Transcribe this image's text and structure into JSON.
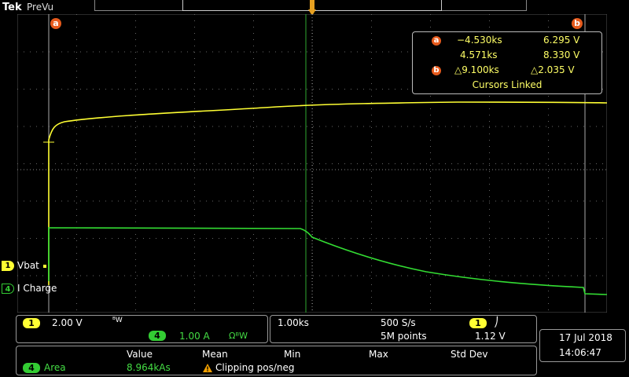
{
  "header": {
    "brand": "Tek",
    "mode": "PreVu"
  },
  "cursors": {
    "a_label": "a",
    "b_label": "b",
    "readout": {
      "a_time": "−4.530ks",
      "a_value": "6.295 V",
      "b_time": "4.571ks",
      "b_value": "8.330 V",
      "delta_time": "△9.100ks",
      "delta_value": "△2.035 V",
      "linked": "Cursors Linked"
    }
  },
  "channels": {
    "ch1": {
      "number": "1",
      "name": "Vbat",
      "scale": "2.00 V",
      "bw": "ᴮW",
      "color": "#ffff33"
    },
    "ch4": {
      "number": "4",
      "name": "I Charge",
      "scale": "1.00 A",
      "bw": "ΩᴮW",
      "color": "#33cc33"
    }
  },
  "horizontal": {
    "timebase": "1.00ks",
    "sample_rate": "500 S/s",
    "record_length": "5M points"
  },
  "trigger": {
    "source": "1",
    "slope": "⎠",
    "level": "1.12 V"
  },
  "datetime": {
    "date": "17 Jul  2018",
    "time": "14:06:47"
  },
  "measurements": {
    "headers": {
      "value": "Value",
      "mean": "Mean",
      "min": "Min",
      "max": "Max",
      "std": "Std Dev"
    },
    "row": {
      "channel": "4",
      "name": "Area",
      "value": "8.964kAs",
      "warning": "Clipping pos/neg"
    }
  }
}
